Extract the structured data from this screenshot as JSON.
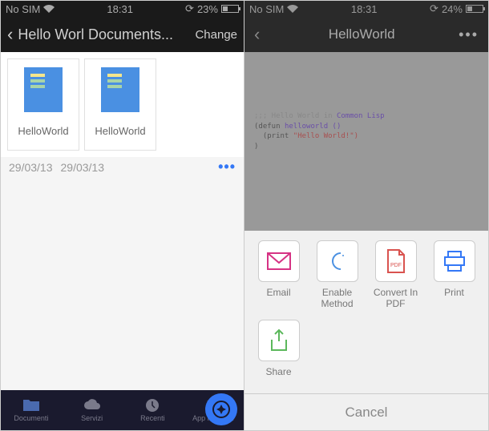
{
  "left": {
    "status": {
      "carrier": "No SIM",
      "time": "18:31",
      "battery": "23%"
    },
    "nav": {
      "title": "Hello Worl Documents...",
      "action": "Change"
    },
    "docs": [
      {
        "name": "HelloWorld",
        "date": "29/03/13"
      },
      {
        "name": "HelloWorld",
        "date": "29/03/13"
      }
    ],
    "tabs": {
      "documenti": "Documenti",
      "servizi": "Servizi",
      "recenti": "Recenti",
      "app_readdle": "App Readdle"
    }
  },
  "right": {
    "status": {
      "carrier": "No SIM",
      "time": "18:31",
      "battery": "24%"
    },
    "nav": {
      "title": "HelloWorld"
    },
    "code": {
      "comment": ";;; Hello World in",
      "lang": "Common Lisp",
      "line1a": "(defun",
      "line1b": "helloworld ()",
      "line2a": "(print",
      "line2b": "\"Hello World!\")",
      "line3": ")"
    },
    "actions": {
      "email": "Email",
      "enable": "Enable Method",
      "convert": "Convert In PDF",
      "print": "Print",
      "share": "Share",
      "cancel": "Cancel"
    }
  }
}
